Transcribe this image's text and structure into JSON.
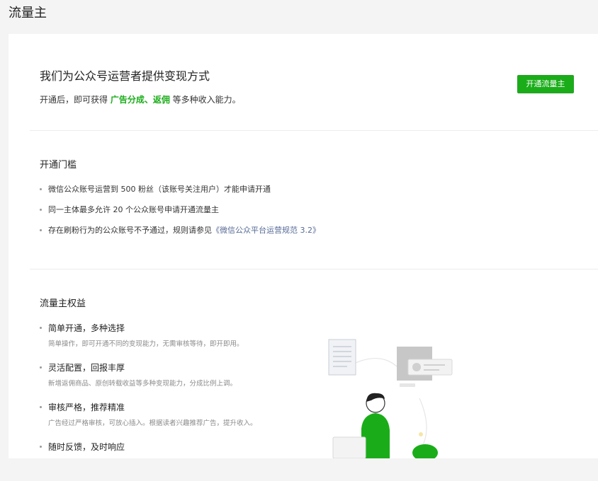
{
  "page": {
    "title": "流量主"
  },
  "hero": {
    "heading": "我们为公众号运营者提供变现方式",
    "desc_prefix": "开通后，即可获得 ",
    "desc_highlight": "广告分成、返佣",
    "desc_suffix": " 等多种收入能力。",
    "button_label": "开通流量主"
  },
  "requirements": {
    "title": "开通门槛",
    "items": [
      "微信公众账号运营到 500 粉丝（该账号关注用户）才能申请开通",
      "同一主体最多允许 20 个公众账号申请开通流量主"
    ],
    "item3_prefix": "存在刷粉行为的公众账号不予通过，规则请参见",
    "item3_link": "《微信公众平台运营规范 3.2》"
  },
  "benefits": {
    "title": "流量主权益",
    "items": [
      {
        "title": "简单开通，多种选择",
        "desc": "简单操作，即可开通不同的变现能力，无需审核等待，即开即用。"
      },
      {
        "title": "灵活配置，回报丰厚",
        "desc": "新增返佣商品、原创转载收益等多种变现能力，分成比例上调。"
      },
      {
        "title": "审核严格，推荐精准",
        "desc": "广告经过严格审核，可放心插入。根据读者兴趣推荐广告，提升收入。"
      },
      {
        "title": "随时反馈，及时响应",
        "desc": ""
      }
    ]
  },
  "colors": {
    "accent": "#1aad19",
    "link": "#576b95"
  }
}
